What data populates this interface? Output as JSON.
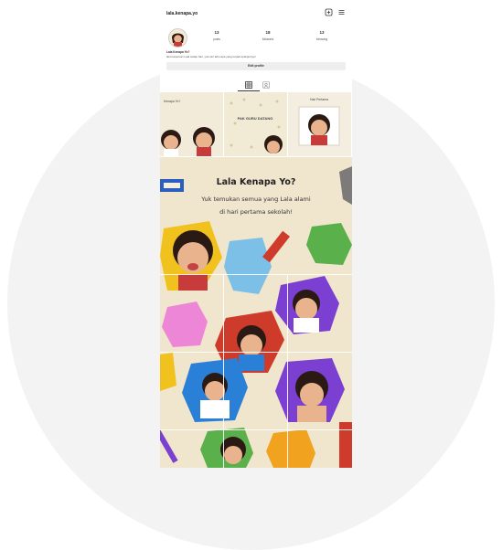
{
  "profile": {
    "username": "lala.kenapa.yo",
    "stats": [
      {
        "number": "13",
        "label": "posts"
      },
      {
        "number": "18",
        "label": "followers"
      },
      {
        "number": "13",
        "label": "following"
      }
    ],
    "bio_name": "Lala Kenapa Yo?",
    "bio_text": "Ikuti keseruan Lala setiap hari, yuk cari tahu apa yang terjadi selanjutnya!",
    "edit_button": "Edit profile"
  },
  "posts": {
    "post1_label": "Kenapa Yo?",
    "post2_label": "PAK GURU DATANG",
    "post3_label": "Hari Pertama"
  },
  "feature": {
    "title": "Lala Kenapa Yo?",
    "subtitle_line1": "Yuk temukan semua yang Lala alami",
    "subtitle_line2": "di hari pertama sekolah!"
  },
  "colors": {
    "cream": "#f0e6cd",
    "yellow": "#f1c11e",
    "blue": "#2a7fd6",
    "purple": "#7b3fd1",
    "green": "#5ab04a",
    "red": "#cf3b2a",
    "pink": "#ee86d8"
  },
  "icons": [
    "add-post-icon",
    "menu-icon",
    "grid-icon",
    "tagged-icon"
  ]
}
